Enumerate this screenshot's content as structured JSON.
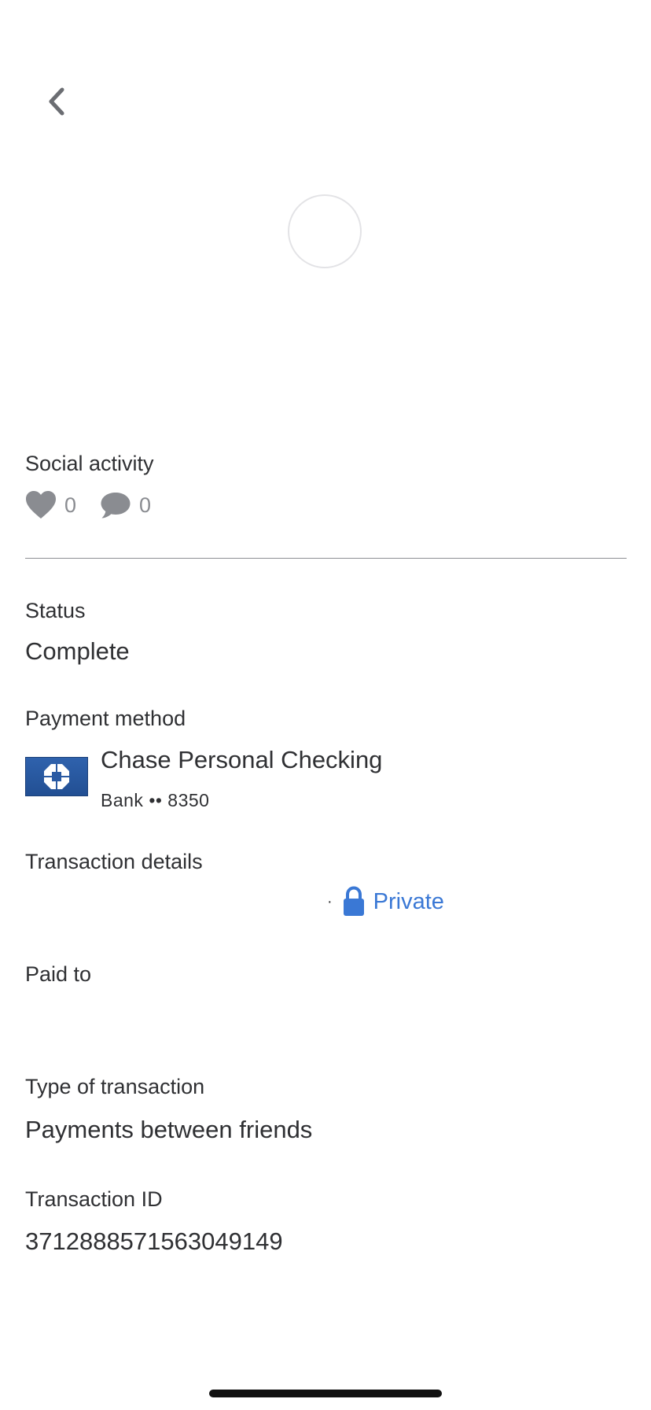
{
  "social": {
    "heading": "Social activity",
    "likes_count": "0",
    "comments_count": "0"
  },
  "status": {
    "label": "Status",
    "value": "Complete"
  },
  "payment_method": {
    "label": "Payment method",
    "bank_name": "Chase Personal Checking",
    "bank_detail": "Bank •• 8350",
    "logo_color": "#2a5aa3"
  },
  "transaction_details": {
    "label": "Transaction details",
    "separator": "·",
    "privacy": "Private",
    "privacy_color": "#3a78d5"
  },
  "paid_to": {
    "label": "Paid to"
  },
  "transaction_type": {
    "label": "Type of transaction",
    "value": "Payments between friends"
  },
  "transaction_id": {
    "label": "Transaction ID",
    "value": "3712888571563049149"
  },
  "icons": {
    "back": "chevron-left-icon",
    "like": "heart-icon",
    "comment": "comment-icon",
    "privacy": "lock-icon",
    "bank": "chase-octagon-icon"
  }
}
